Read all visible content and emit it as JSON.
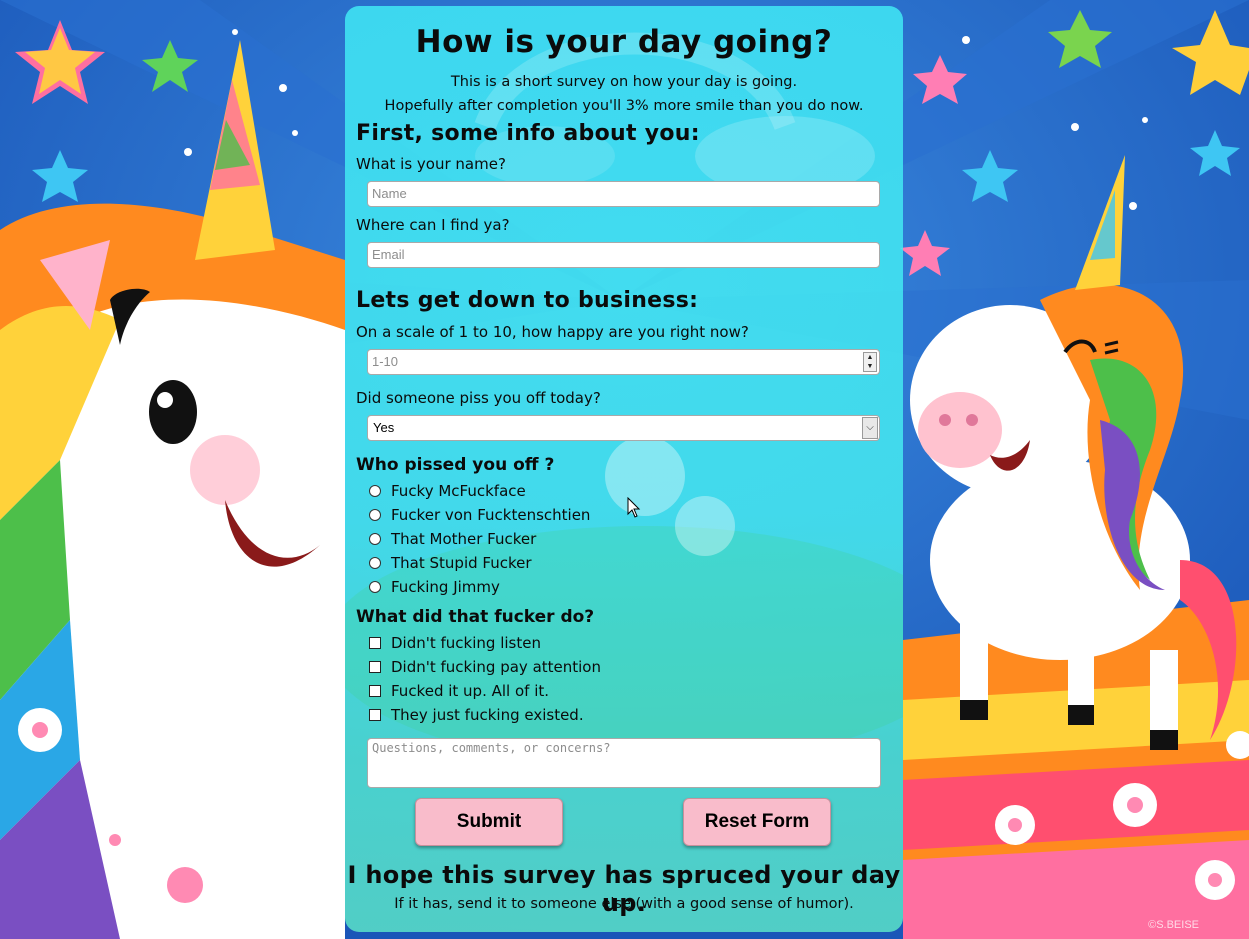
{
  "survey": {
    "title": "How is your day going?",
    "intro_line1": "This is a short survey on how your day is going.",
    "intro_line2": "Hopefully after completion you'll 3% more smile than you do now.",
    "section_about": "First, some info about you:",
    "name_question": "What is your name?",
    "name_placeholder": "Name",
    "email_question": "Where can I find ya?",
    "email_placeholder": "Email",
    "section_business": "Lets get down to business:",
    "happy_question": "On a scale of 1 to 10, how happy are you right now?",
    "happy_placeholder": "1-10",
    "piss_question": "Did someone piss you off today?",
    "piss_selected": "Yes",
    "who_question": "Who pissed you off ?",
    "who_options": [
      "Fucky McFuckface",
      "Fucker von Fucktenschtien",
      "That Mother Fucker",
      "That Stupid Fucker",
      "Fucking Jimmy"
    ],
    "what_question": "What did that fucker do?",
    "what_options": [
      "Didn't fucking listen",
      "Didn't fucking pay attention",
      "Fucked it up. All of it.",
      "They just fucking existed."
    ],
    "comments_placeholder": "Questions, comments, or concerns?",
    "submit_label": "Submit",
    "reset_label": "Reset Form",
    "closing_title": "I hope this survey has spruced your day up.",
    "closing_sub": "If it has, send it to someone else (with a good sense of humor)."
  },
  "background": {
    "credit": "©S.BEISE",
    "colors": {
      "sky": "#1f63c4",
      "button_fill": "#f9bccb",
      "panel": "#40e8f5"
    }
  }
}
